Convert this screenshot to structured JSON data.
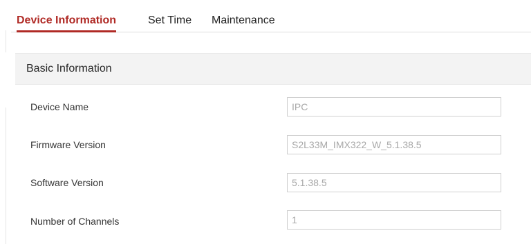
{
  "tabs": [
    {
      "label": "Device Information",
      "active": true
    },
    {
      "label": "Set Time",
      "active": false
    },
    {
      "label": "Maintenance",
      "active": false
    }
  ],
  "section": {
    "title": "Basic Information"
  },
  "fields": [
    {
      "label": "Device Name",
      "value": "IPC"
    },
    {
      "label": "Firmware Version",
      "value": "S2L33M_IMX322_W_5.1.38.5"
    },
    {
      "label": "Software Version",
      "value": "5.1.38.5"
    },
    {
      "label": "Number of Channels",
      "value": "1"
    }
  ],
  "colors": {
    "accent": "#b02a25",
    "section_bg": "#f3f3f3",
    "input_text": "#a8a8a8"
  }
}
